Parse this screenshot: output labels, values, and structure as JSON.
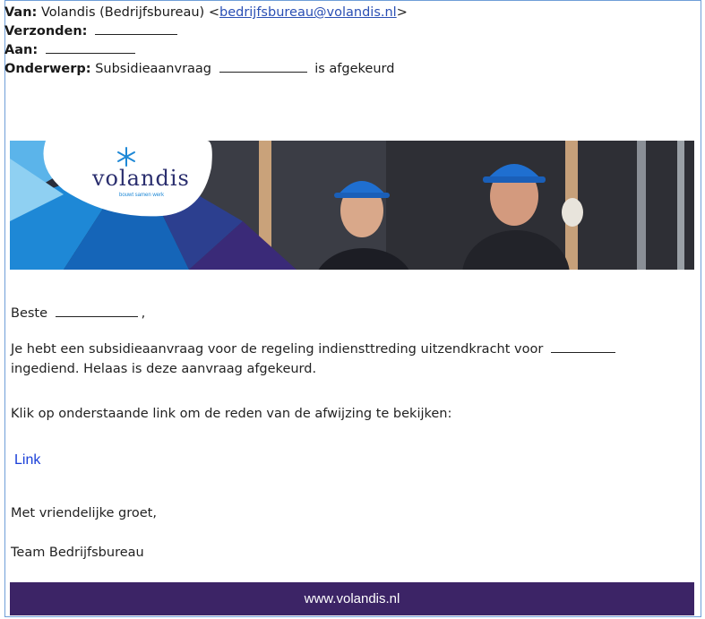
{
  "headers": {
    "from_label": "Van:",
    "from_name": "Volandis (Bedrijfsbureau) <",
    "from_email": "bedrijfsbureau@volandis.nl",
    "from_close": ">",
    "sent_label": "Verzonden:",
    "to_label": "Aan:",
    "subject_label": "Onderwerp:",
    "subject_prefix": "Subsidieaanvraag",
    "subject_suffix": "is afgekeurd"
  },
  "banner": {
    "logo_text": "volandis",
    "logo_tagline": "bouwt samen werk"
  },
  "body": {
    "greeting": "Beste",
    "greeting_comma": ",",
    "paragraph1_line1": "Je hebt een subsidieaanvraag voor de regeling indiensttreding uitzendkracht voor",
    "paragraph1_line2": "ingediend. Helaas is deze aanvraag afgekeurd.",
    "paragraph2": "Klik op onderstaande link om de reden van de afwijzing te bekijken:",
    "link_label": "Link",
    "closing": "Met vriendelijke groet,",
    "signature": "Team Bedrijfsbureau"
  },
  "footer": {
    "url": "www.volandis.nl"
  },
  "colors": {
    "footer_bg": "#3c2466",
    "link": "#1a3fd8",
    "email_link": "#2a4fb4",
    "banner_blue": "#1e88d6",
    "banner_dark": "#23263f"
  }
}
